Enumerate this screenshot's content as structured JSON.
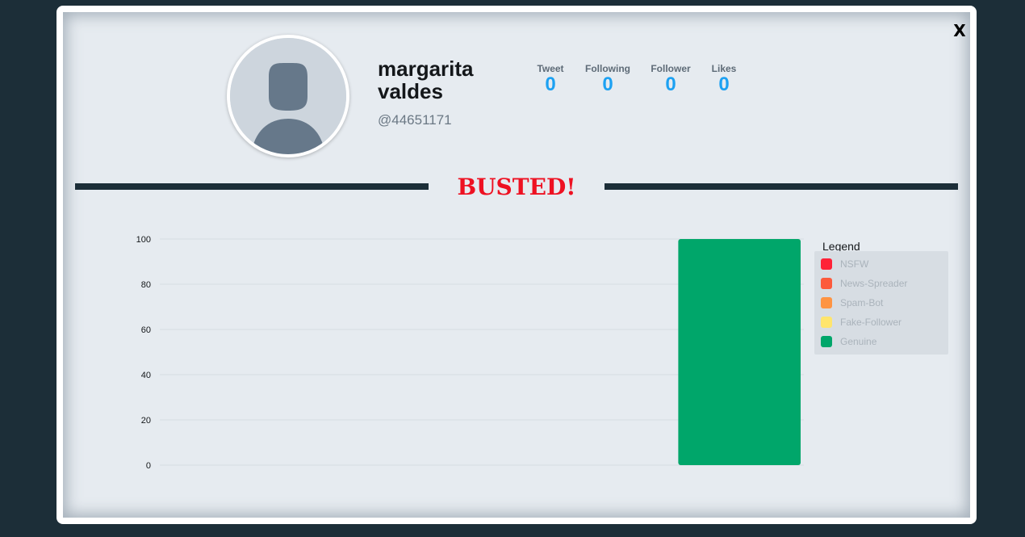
{
  "modal": {
    "close_label": "X"
  },
  "profile": {
    "name": "margarita valdes",
    "handle": "@44651171",
    "stats": [
      {
        "label": "Tweet",
        "value": "0"
      },
      {
        "label": "Following",
        "value": "0"
      },
      {
        "label": "Follower",
        "value": "0"
      },
      {
        "label": "Likes",
        "value": "0"
      }
    ],
    "avatar_icon": "default-user-silhouette-icon"
  },
  "verdict": {
    "text": "BUSTED!",
    "color": "#ee1122"
  },
  "legend": {
    "title": "Legend",
    "items": [
      {
        "label": "NSFW",
        "color": "#ff2237"
      },
      {
        "label": "News-Spreader",
        "color": "#fc5a3c"
      },
      {
        "label": "Spam-Bot",
        "color": "#fe9443"
      },
      {
        "label": "Fake-Follower",
        "color": "#ffe56d"
      },
      {
        "label": "Genuine",
        "color": "#00a66a"
      }
    ]
  },
  "chart_data": {
    "type": "bar",
    "categories": [
      "NSFW",
      "News-Spreader",
      "Spam-Bot",
      "Fake-Follower",
      "Genuine"
    ],
    "values": [
      0,
      0,
      0,
      0,
      100
    ],
    "colors": [
      "#ff2237",
      "#fc5a3c",
      "#fe9443",
      "#ffe56d",
      "#00a66a"
    ],
    "ylim": [
      0,
      100
    ],
    "yticks": [
      0,
      20,
      40,
      60,
      80,
      100
    ],
    "grid": true,
    "legend_position": "right",
    "title": "",
    "xlabel": "",
    "ylabel": ""
  }
}
